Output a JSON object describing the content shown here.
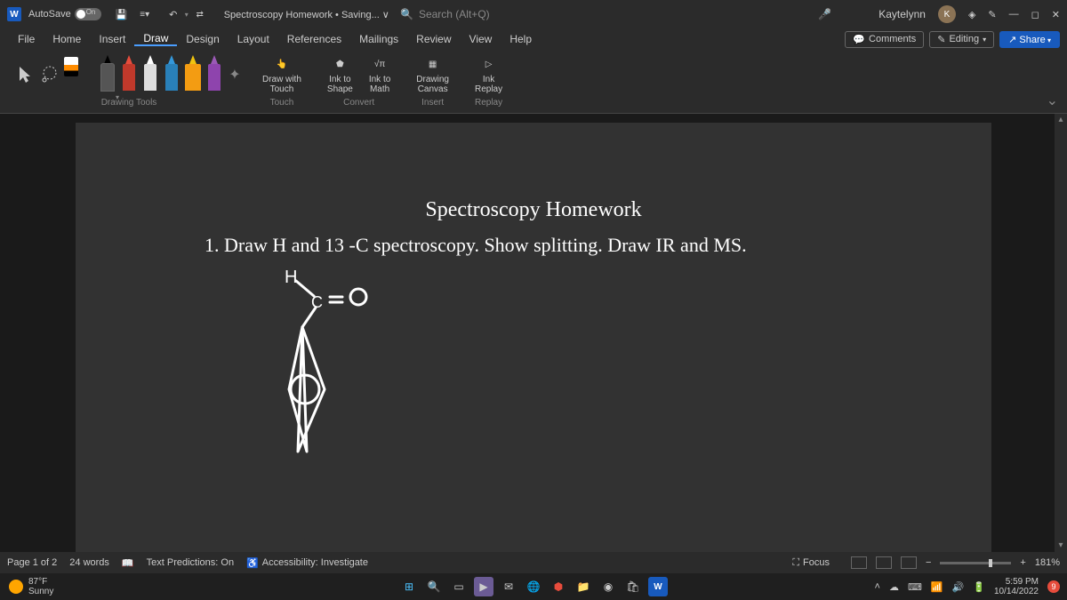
{
  "titlebar": {
    "autosave_label": "AutoSave",
    "autosave_state": "On",
    "doc_title": "Spectroscopy Homework • Saving... ∨",
    "search_placeholder": "Search (Alt+Q)",
    "user_name": "Kaytelynn",
    "user_initial": "K"
  },
  "menu": {
    "items": [
      "File",
      "Home",
      "Insert",
      "Draw",
      "Design",
      "Layout",
      "References",
      "Mailings",
      "Review",
      "View",
      "Help"
    ],
    "active": "Draw",
    "comments": "Comments",
    "editing": "Editing",
    "share": "Share"
  },
  "ribbon": {
    "groups": {
      "drawing_tools": "Drawing Tools",
      "touch": "Touch",
      "convert": "Convert",
      "insert": "Insert",
      "replay": "Replay"
    },
    "buttons": {
      "draw_touch": "Draw with\nTouch",
      "ink_shape": "Ink to\nShape",
      "ink_math": "Ink to\nMath",
      "drawing_canvas": "Drawing\nCanvas",
      "ink_replay": "Ink\nReplay"
    }
  },
  "document": {
    "heading": "Spectroscopy Homework",
    "body": "1.   Draw H and 13 -C spectroscopy. Show splitting. Draw IR and MS."
  },
  "statusbar": {
    "page": "Page 1 of 2",
    "words": "24 words",
    "predictions": "Text Predictions: On",
    "accessibility": "Accessibility: Investigate",
    "focus": "Focus",
    "zoom": "181%"
  },
  "taskbar": {
    "temp": "87°F",
    "condition": "Sunny",
    "time": "5:59 PM",
    "date": "10/14/2022",
    "notif_count": "9"
  }
}
